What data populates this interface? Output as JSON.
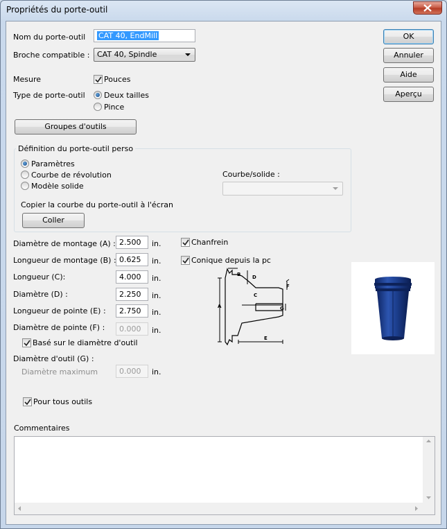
{
  "window": {
    "title": "Propriétés du porte-outil"
  },
  "fields": {
    "name_label": "Nom du porte-outil",
    "name_value": "CAT 40, EndMill",
    "spindle_label": "Broche compatible :",
    "spindle_value": "CAT 40, Spindle",
    "measure_label": "Mesure",
    "inches_label": "Pouces",
    "holder_type_label": "Type de porte-outil",
    "two_sizes_label": "Deux tailles",
    "collet_label": "Pince",
    "tool_groups_button": "Groupes d'outils"
  },
  "custom_group": {
    "title": "Définition du porte-outil perso",
    "params_label": "Paramètres",
    "revolution_label": "Courbe de révolution",
    "solid_label": "Modèle solide",
    "curve_solid_label": "Courbe/solide :",
    "copy_label": "Copier la courbe du porte-outil à l'écran",
    "paste_button": "Coller"
  },
  "dimensions": {
    "mount_diameter_label": "Diamètre de montage (A) :",
    "mount_diameter_value": "2.500",
    "mount_length_label": "Longueur de montage (B) :",
    "mount_length_value": "0.625",
    "length_label": "Longueur (C):",
    "length_value": "4.000",
    "diameter_label": "Diamètre (D) :",
    "diameter_value": "2.250",
    "tip_length_label": "Longueur de pointe (E) :",
    "tip_length_value": "2.750",
    "tip_diameter_label": "Diamètre de pointe (F) :",
    "tip_diameter_value": "0.000",
    "based_on_tool_label": "Basé sur le diamètre d'outil",
    "tool_diameter_label": "Diamètre d'outil (G) :",
    "max_diameter_label": "Diamètre maximum",
    "max_diameter_value": "0.000",
    "unit": "in.",
    "all_tools_label": "Pour tous outils"
  },
  "options": {
    "chamfer_label": "Chanfrein",
    "conical_label": "Conique depuis la pc"
  },
  "diagram": {
    "labels": [
      "B",
      "D",
      "F",
      "C",
      "A",
      "G",
      "E"
    ]
  },
  "buttons": {
    "ok": "OK",
    "cancel": "Annuler",
    "help": "Aide",
    "preview": "Aperçu"
  },
  "comments": {
    "label": "Commentaires",
    "value": ""
  },
  "colors": {
    "preview_body": "#1f3f8c",
    "selection": "#3399ff",
    "close_button": "#c5553f"
  }
}
